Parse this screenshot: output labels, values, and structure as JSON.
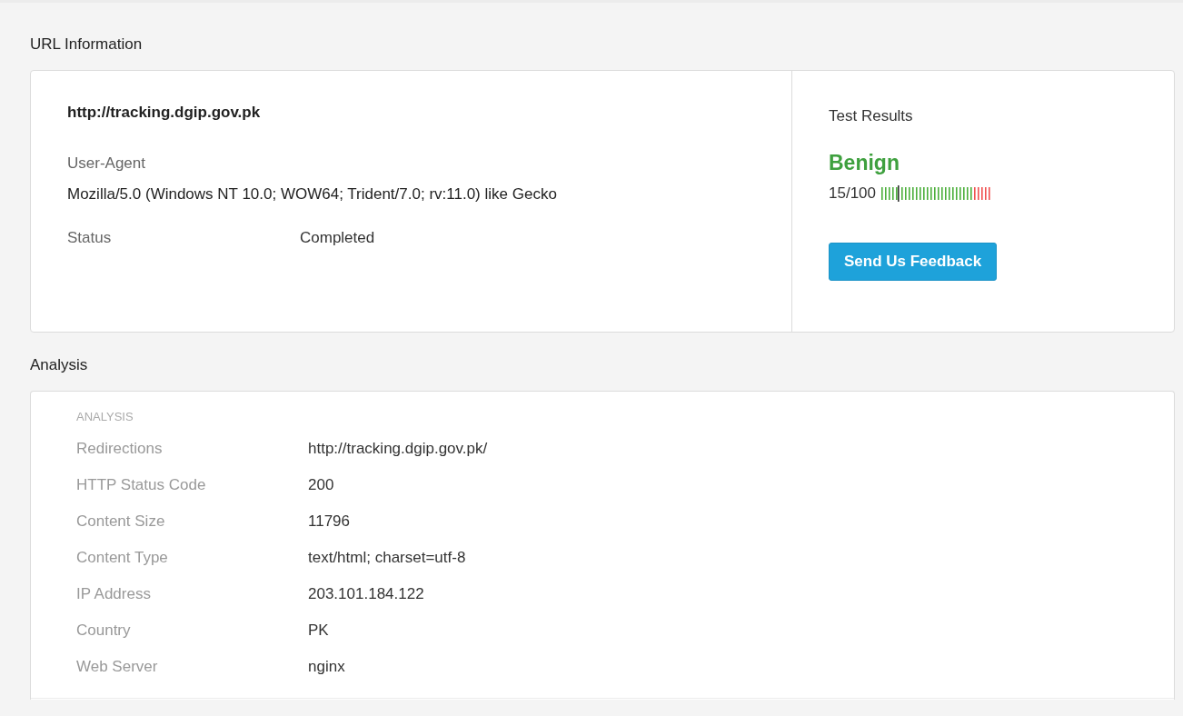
{
  "url_information": {
    "heading": "URL Information",
    "url": "http://tracking.dgip.gov.pk",
    "user_agent_label": "User-Agent",
    "user_agent": "Mozilla/5.0 (Windows NT 10.0; WOW64; Trident/7.0; rv:11.0) like Gecko",
    "status_label": "Status",
    "status": "Completed"
  },
  "test_results": {
    "heading": "Test Results",
    "verdict": "Benign",
    "score": "15/100",
    "level": 0.15,
    "button": "Send Us Feedback"
  },
  "analysis": {
    "heading": "Analysis",
    "section_label": "ANALYSIS",
    "rows": [
      {
        "label": "Redirections",
        "value": "http://tracking.dgip.gov.pk/"
      },
      {
        "label": "HTTP Status Code",
        "value": "200"
      },
      {
        "label": "Content Size",
        "value": "11796"
      },
      {
        "label": "Content Type",
        "value": "text/html; charset=utf-8"
      },
      {
        "label": "IP Address",
        "value": "203.101.184.122"
      },
      {
        "label": "Country",
        "value": "PK"
      },
      {
        "label": "Web Server",
        "value": "nginx"
      }
    ]
  }
}
